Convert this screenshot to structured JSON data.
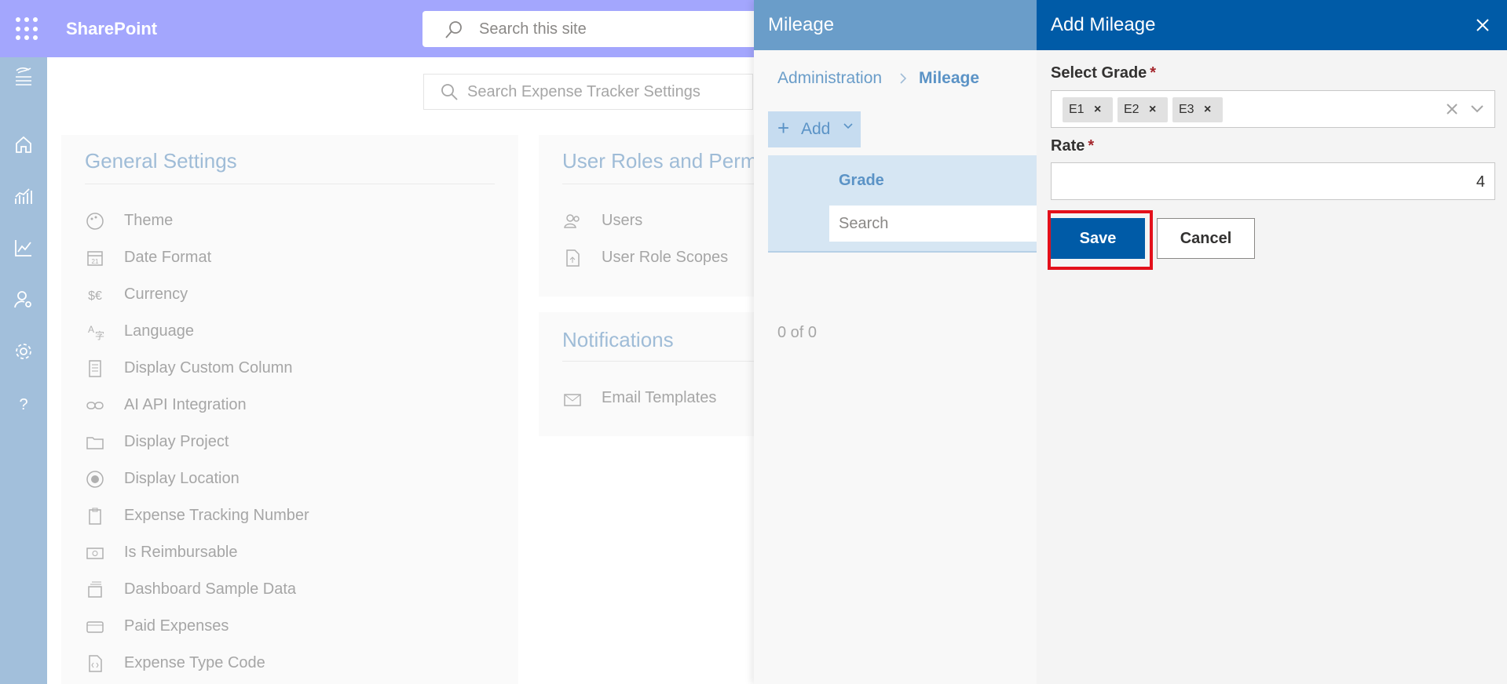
{
  "topbar": {
    "brand": "SharePoint",
    "search_placeholder": "Search this site"
  },
  "rail": {
    "icons": [
      "expense-logo-icon",
      "home-icon",
      "reports-icon",
      "analytics-icon",
      "user-settings-icon",
      "settings-icon",
      "help-icon"
    ]
  },
  "main": {
    "settings_search_placeholder": "Search Expense Tracker Settings",
    "general": {
      "title": "General Settings",
      "items": [
        {
          "label": "Theme",
          "icon": "palette-icon"
        },
        {
          "label": "Date Format",
          "icon": "calendar-icon"
        },
        {
          "label": "Currency",
          "icon": "currency-icon"
        },
        {
          "label": "Language",
          "icon": "language-icon"
        },
        {
          "label": "Display Custom Column",
          "icon": "column-icon"
        },
        {
          "label": "AI API Integration",
          "icon": "link-icon"
        },
        {
          "label": "Display Project",
          "icon": "project-icon"
        },
        {
          "label": "Display Location",
          "icon": "location-icon"
        },
        {
          "label": "Expense Tracking Number",
          "icon": "clipboard-icon"
        },
        {
          "label": "Is Reimbursable",
          "icon": "money-icon"
        },
        {
          "label": "Dashboard Sample Data",
          "icon": "stack-icon"
        },
        {
          "label": "Paid Expenses",
          "icon": "card-icon"
        },
        {
          "label": "Expense Type Code",
          "icon": "code-file-icon"
        }
      ]
    },
    "roles": {
      "title": "User Roles and Perm",
      "items": [
        {
          "label": "Users",
          "icon": "users-icon"
        },
        {
          "label": "User Role Scopes",
          "icon": "role-scope-icon"
        }
      ]
    },
    "notifications": {
      "title": "Notifications",
      "items": [
        {
          "label": "Email Templates",
          "icon": "email-template-icon"
        }
      ]
    }
  },
  "mileage_panel": {
    "title": "Mileage",
    "breadcrumb": [
      "Administration",
      "Mileage"
    ],
    "add_label": "Add",
    "grade_header": "Grade",
    "grade_search_placeholder": "Search",
    "count": "0 of 0"
  },
  "add_mileage": {
    "title": "Add Mileage",
    "grade_label": "Select Grade",
    "required_mark": "*",
    "grades": [
      "E1",
      "E2",
      "E3"
    ],
    "chip_remove": "×",
    "rate_label": "Rate",
    "rate_value": "4",
    "save_label": "Save",
    "cancel_label": "Cancel",
    "highlight_color": "#e3101b",
    "accent_color": "#005ba7"
  }
}
